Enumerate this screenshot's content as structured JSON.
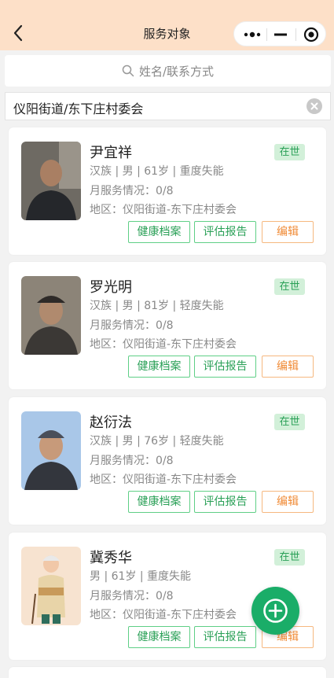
{
  "nav": {
    "title": "服务对象"
  },
  "search": {
    "placeholder": "姓名/联系方式"
  },
  "region": {
    "value": "仪阳街道/东下庄村委会"
  },
  "buttons": {
    "health": "健康档案",
    "report": "评估报告",
    "edit": "编辑"
  },
  "colors": {
    "nav_bg": "#fde0c8",
    "accent_green": "#1aad68",
    "edit_orange": "#f08a35"
  },
  "cards": [
    {
      "name": "尹宜祥",
      "status": "在世",
      "line1": "汉族 | 男 | 61岁 | 重度失能",
      "line2": "月服务情况：0/8",
      "line3": "地区：仪阳街道-东下庄村委会"
    },
    {
      "name": "罗光明",
      "status": "在世",
      "line1": "汉族 | 男 | 81岁 | 轻度失能",
      "line2": "月服务情况：0/8",
      "line3": "地区：仪阳街道-东下庄村委会"
    },
    {
      "name": "赵衍法",
      "status": "在世",
      "line1": "汉族 | 男 | 76岁 | 轻度失能",
      "line2": "月服务情况：0/8",
      "line3": "地区：仪阳街道-东下庄村委会"
    },
    {
      "name": "冀秀华",
      "status": "在世",
      "line1": "男 | 61岁 | 重度失能",
      "line2": "月服务情况：0/8",
      "line3": "地区：仪阳街道-东下庄村委会"
    }
  ],
  "icons": {
    "back": "back-arrow-icon",
    "more": "more-dots-icon",
    "minimize": "minimize-icon",
    "close": "target-close-icon",
    "search": "search-icon",
    "clear": "clear-icon",
    "add": "plus-circle-icon"
  }
}
